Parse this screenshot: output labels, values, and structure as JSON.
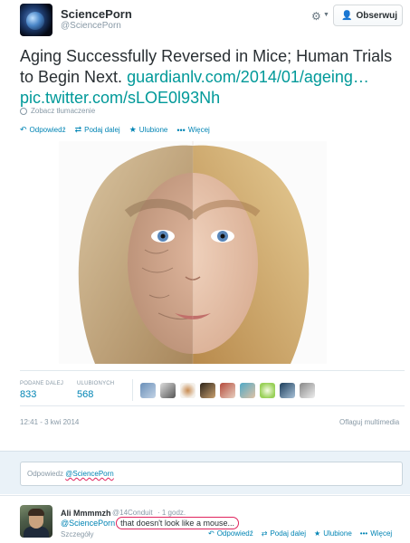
{
  "tweet": {
    "author_name": "SciencePorn",
    "author_handle": "@SciencePorn",
    "follow_label": "Obserwuj",
    "text": "Aging Successfully Reversed in Mice; Human Trials to Begin Next.",
    "link_url": "guardianlv.com/2014/01/ageing…",
    "pic_url": "pic.twitter.com/sLOE0l93Nh",
    "translate_label": "Zobacz tłumaczenie",
    "actions": {
      "reply": "Odpowiedź",
      "retweet": "Podaj dalej",
      "favorite": "Ulubione",
      "more": "Więcej"
    },
    "stats": {
      "retweets_label": "PODANE DALEJ",
      "retweets_value": "833",
      "favorites_label": "ULUBIONYCH",
      "favorites_value": "568"
    },
    "timestamp": "12:41 - 3 kwi 2014",
    "flag_label": "Oflaguj multimedia"
  },
  "reply_box": {
    "prefix": "Odpowiedz",
    "mention": "@SciencePorn"
  },
  "reply": {
    "author_name": "Ali Mmmmzh",
    "author_handle": "@14Conduit",
    "time": "· 1 godz.",
    "mention": "@SciencePorn",
    "text": "that doesn't look like a mouse...",
    "details_label": "Szczegóły",
    "actions": {
      "reply": "Odpowiedź",
      "retweet": "Podaj dalej",
      "favorite": "Ulubione",
      "more": "Więcej"
    }
  },
  "colors": {
    "link": "#0084b4",
    "tweet_link": "#009999",
    "muted": "#8899a6",
    "reply_bg": "#eaf2f8",
    "circle": "#e0245e"
  },
  "icons": [
    "globe-icon",
    "reply-icon",
    "retweet-icon",
    "star-icon",
    "more-icon",
    "gear-icon",
    "follow-person-icon"
  ]
}
